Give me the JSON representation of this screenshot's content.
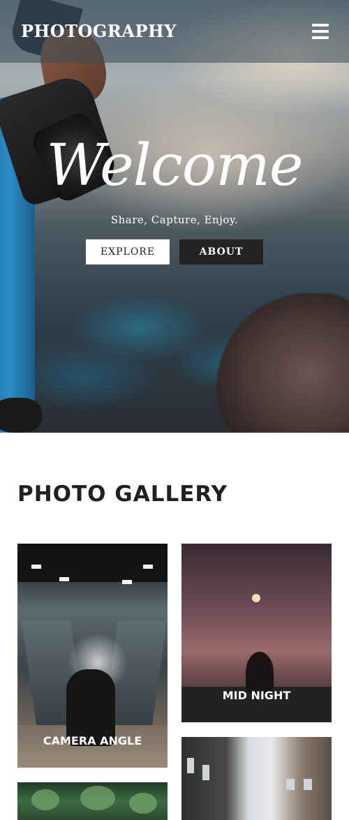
{
  "header": {
    "brand": "PHOTOGRAPHY",
    "menu_icon": "hamburger-menu-icon"
  },
  "hero": {
    "title": "Welcome",
    "tagline": "Share, Capture, Enjoy.",
    "buttons": {
      "explore": "EXPLORE",
      "about": "ABOUT"
    }
  },
  "gallery": {
    "title": "PHOTO GALLERY",
    "items": [
      {
        "label": "CAMERA ANGLE"
      },
      {
        "label": "MID NIGHT"
      },
      {
        "label": ""
      },
      {
        "label": ""
      }
    ]
  },
  "colors": {
    "header_overlay": "#3c4b55",
    "about_button": "#232323",
    "explore_button": "#ffffff",
    "heading_text": "#231f20"
  }
}
